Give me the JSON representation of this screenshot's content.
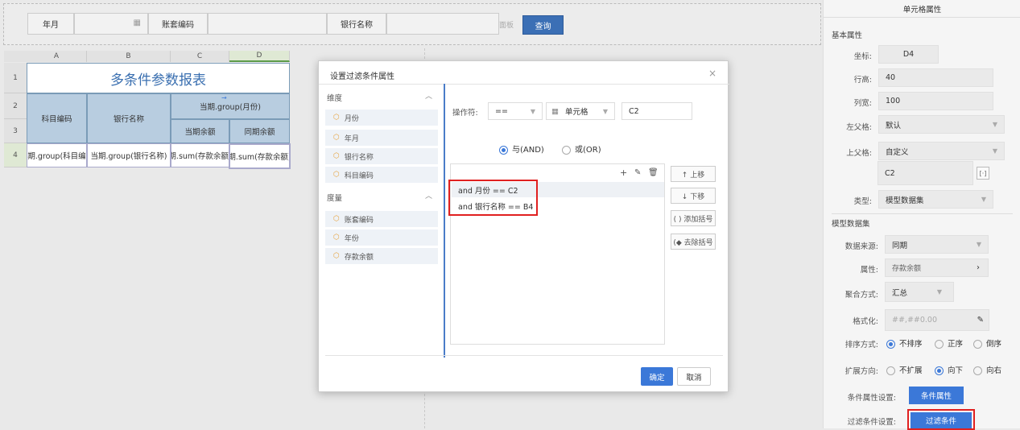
{
  "params": {
    "fields": [
      "年月",
      "账套编码",
      "银行名称"
    ],
    "query_button": "查询",
    "panel_hint": "面板"
  },
  "sheet": {
    "columns": [
      "A",
      "B",
      "C",
      "D"
    ],
    "rows": [
      "1",
      "2",
      "3",
      "4"
    ],
    "title": "多条件参数报表",
    "headers": {
      "subject_code": "科目编码",
      "bank_name": "银行名称",
      "current_group": "当期.group(月份)",
      "current_balance": "当期余额",
      "same_period_balance": "同期余额"
    },
    "row4": [
      "期.group(科目编",
      "当期.group(银行名称)",
      "期.sum(存款余额)",
      "期.sum(存款余额)"
    ]
  },
  "dialog": {
    "title": "设置过滤条件属性",
    "close": "×",
    "dimension_label": "维度",
    "dimension_items": [
      "月份",
      "年月",
      "银行名称",
      "科目编码"
    ],
    "measure_label": "度量",
    "measure_items": [
      "账套编码",
      "年份",
      "存款余额"
    ],
    "operator_label": "操作符:",
    "operator_value": "==",
    "target_type": "单元格",
    "target_value": "C2",
    "and_label": "与(AND)",
    "or_label": "或(OR)",
    "conditions": [
      "and 月份 == C2",
      "and 银行名称 == B4"
    ],
    "buttons": [
      "↑ 上移",
      "↓ 下移",
      "( ) 添加括号",
      "(◆ 去除括号"
    ],
    "toolbar": [
      "+",
      "✎",
      "🗑"
    ],
    "ok": "确定",
    "cancel": "取消"
  },
  "panel": {
    "title": "单元格属性",
    "basic_section": "基本属性",
    "coord_label": "坐标:",
    "coord_value": "D4",
    "row_height_label": "行高:",
    "row_height_value": "40",
    "col_width_label": "列宽:",
    "col_width_value": "100",
    "left_parent_label": "左父格:",
    "left_parent_value": "默认",
    "top_parent_label": "上父格:",
    "top_parent_value": "自定义",
    "top_parent_cell": "C2",
    "type_label": "类型:",
    "type_value": "模型数据集",
    "model_section": "模型数据集",
    "datasource_label": "数据来源:",
    "datasource_value": "同期",
    "attr_label": "属性:",
    "attr_value": "存款余额",
    "agg_label": "聚合方式:",
    "agg_value": "汇总",
    "format_label": "格式化:",
    "format_value": "##,##0.00",
    "sort_label": "排序方式:",
    "sort_options": [
      "不排序",
      "正序",
      "倒序"
    ],
    "expand_label": "扩展方向:",
    "expand_options": [
      "不扩展",
      "向下",
      "向右"
    ],
    "cond_attr_label": "条件属性设置:",
    "cond_attr_button": "条件属性",
    "filter_label": "过滤条件设置:",
    "filter_button": "过滤条件"
  }
}
